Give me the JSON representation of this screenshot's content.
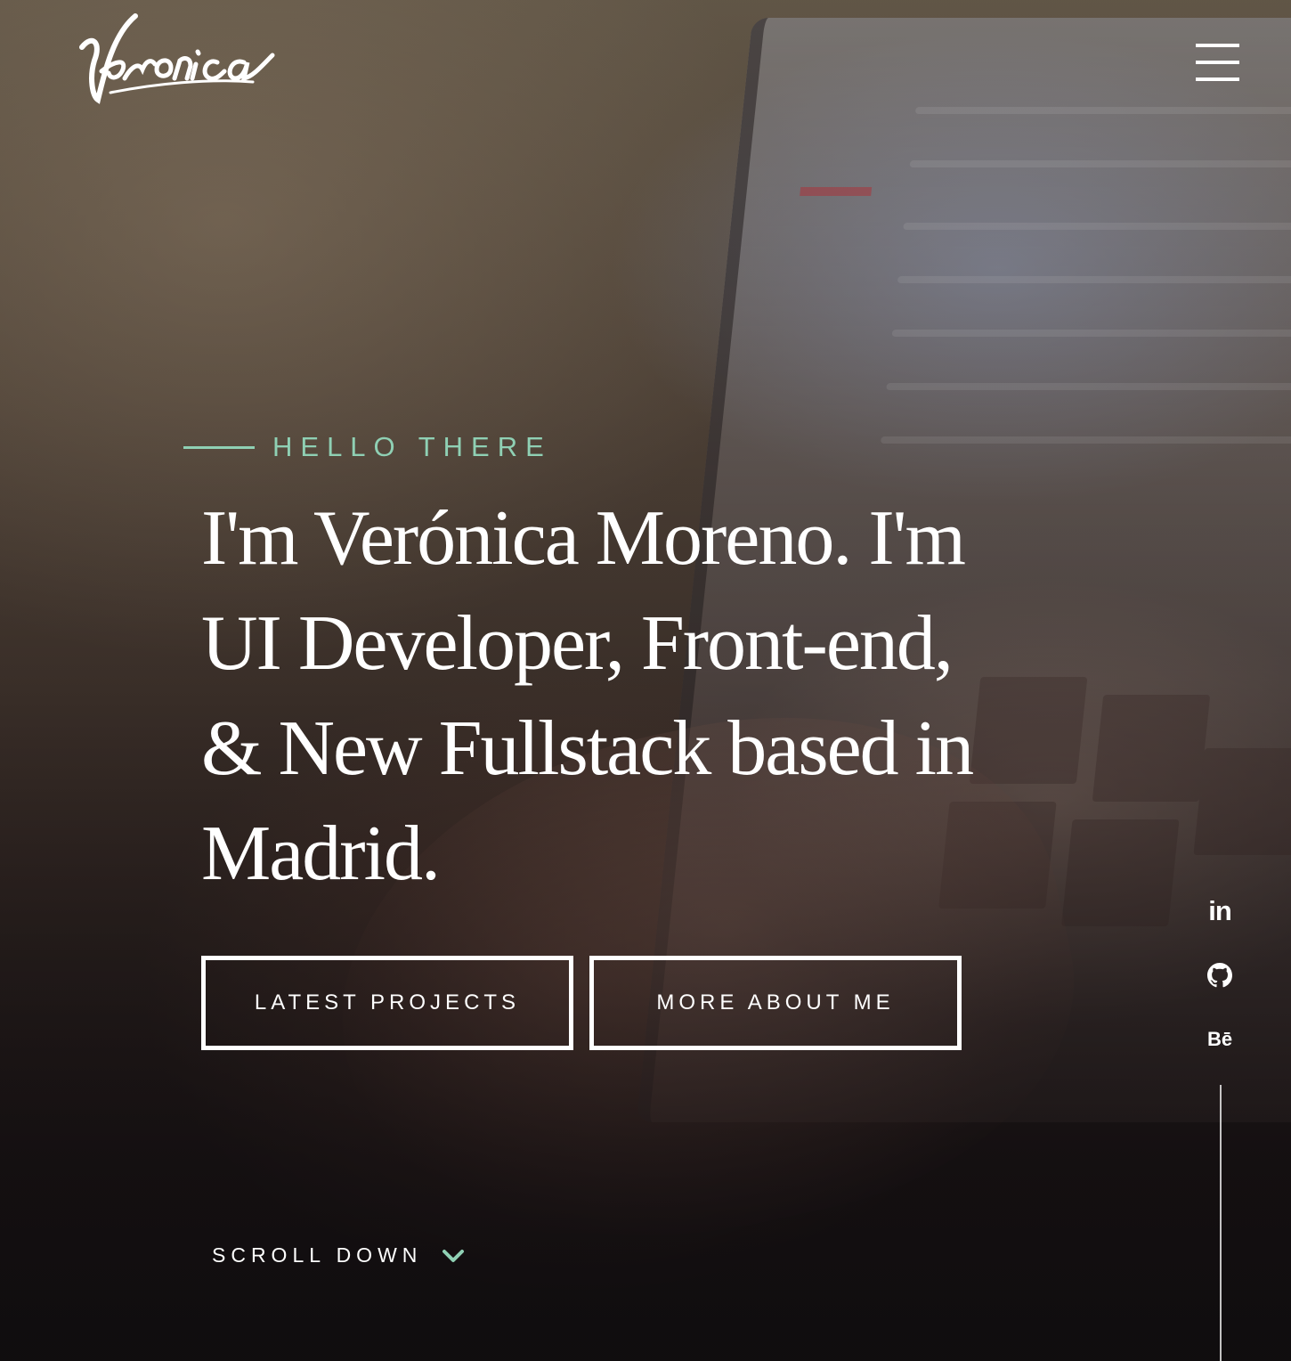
{
  "brand": {
    "logo_text": "Veronica",
    "accent_color": "#8fd0b4"
  },
  "header": {
    "menu_icon": "hamburger-menu-icon"
  },
  "hero": {
    "eyebrow": "HELLO THERE",
    "headline": "I'm Verónica Moreno. I'm UI Developer, Front-end, & New Fullstack based in Madrid."
  },
  "buttons": {
    "latest_projects": "LATEST PROJECTS",
    "more_about_me": "MORE ABOUT ME"
  },
  "social": {
    "linkedin_label": "in",
    "github_icon": "github-icon",
    "behance_label": "Bē"
  },
  "scroll": {
    "label": "SCROLL DOWN",
    "icon": "chevron-down-icon"
  }
}
